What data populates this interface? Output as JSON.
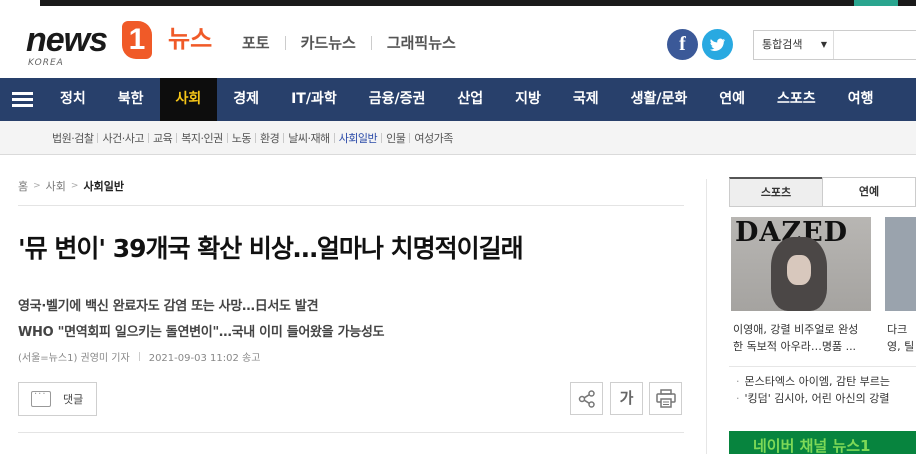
{
  "header": {
    "logo": {
      "news": "news",
      "one": "1",
      "korean": "뉴스",
      "korea": "KOREA"
    },
    "links": [
      "포토",
      "카드뉴스",
      "그래픽뉴스"
    ],
    "sns": {
      "facebook": "f",
      "twitter": "t"
    },
    "search": {
      "select_label": "통합검색",
      "value": ""
    }
  },
  "nav": {
    "items": [
      "정치",
      "북한",
      "사회",
      "경제",
      "IT/과학",
      "금융/증권",
      "산업",
      "지방",
      "국제",
      "생활/문화",
      "연예",
      "스포츠",
      "여행"
    ]
  },
  "subnav": {
    "items": [
      "법원·검찰",
      "사건·사고",
      "교육",
      "복지·인권",
      "노동",
      "환경",
      "날씨·재해",
      "사회일반",
      "인물",
      "여성가족"
    ]
  },
  "breadcrumb": {
    "home": "홈",
    "section": "사회",
    "current": "사회일반"
  },
  "article": {
    "headline": "'뮤 변이' 39개국 확산 비상…얼마나 치명적이길래",
    "sub1": "영국·벨기에 백신 완료자도 감염 또는 사망…日서도 발견",
    "sub2": "WHO \"면역회피 일으키는 돌연변이\"…국내 이미 들어왔을 가능성도",
    "byline": "(서울=뉴스1) 권영미 기자",
    "datetime": "2021-09-03 11:02 송고",
    "comment_label": "댓글",
    "font_label": "가"
  },
  "sidebar": {
    "tabs": [
      "스포츠",
      "연예"
    ],
    "thumb_title": "DAZED",
    "cap1_line1": "이영애, 강렬 비주얼로 완성",
    "cap1_line2": "한 독보적 아우라…명품 ...",
    "cap2_line1": "다크",
    "cap2_line2": "영, 틸",
    "list": [
      "몬스타엑스 아이엠, 감탄 부르는",
      "'킹덤' 김시아, 어린 아신의 강렬"
    ],
    "banner": "네이버 채널 뉴스1"
  },
  "colors": {
    "nav_bg": "#28406b",
    "nav_active_text": "#f5c518",
    "logo_accent": "#f05a28",
    "subnav_active": "#2a4aa8",
    "banner_bg": "#07843e"
  }
}
